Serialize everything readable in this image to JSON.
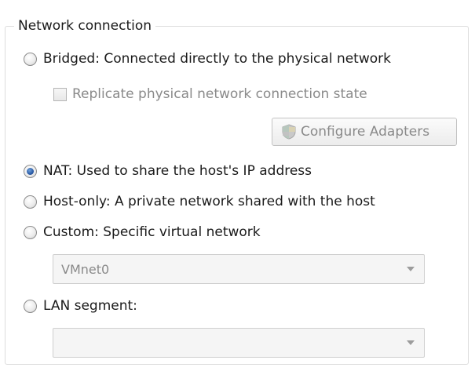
{
  "group": {
    "title": "Network connection"
  },
  "options": {
    "bridged": {
      "label": "Bridged: Connected directly to the physical network",
      "checked": false
    },
    "replicate": {
      "label": "Replicate physical network connection state",
      "checked": false,
      "enabled": false
    },
    "configure_adapters": {
      "label": "Configure Adapters",
      "enabled": false,
      "icon": "adapters-shield-icon"
    },
    "nat": {
      "label": "NAT: Used to share the host's IP address",
      "checked": true
    },
    "host_only": {
      "label": "Host-only: A private network shared with the host",
      "checked": false
    },
    "custom": {
      "label": "Custom: Specific virtual network",
      "checked": false
    },
    "custom_network": {
      "value": "VMnet0",
      "enabled": false
    },
    "lan_segment": {
      "label": "LAN segment:",
      "checked": false
    },
    "lan_segment_select": {
      "value": "",
      "enabled": false
    }
  },
  "colors": {
    "radio_selected": "#2a5aa6",
    "disabled_text": "#8a8a8a",
    "group_border": "#dcdcdc"
  }
}
